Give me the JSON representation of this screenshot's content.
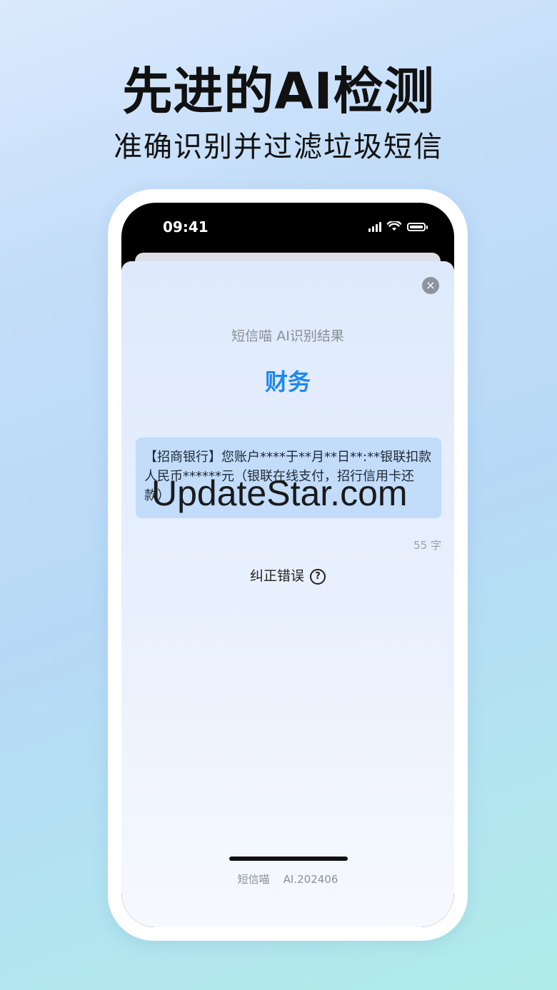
{
  "headline": "先进的AI检测",
  "subheadline": "准确识别并过滤垃圾短信",
  "phone": {
    "status_bar": {
      "time": "09:41"
    },
    "sheet": {
      "close_icon": "×",
      "title": "短信喵 AI识别结果",
      "category": "财务",
      "message": "【招商银行】您账户****于**月**日**:**银联扣款人民币******元（银联在线支付，招行信用卡还款）",
      "watermark": "UpdateStar.com",
      "char_count": "55 字",
      "correct_label": "纠正错误",
      "help_icon": "?",
      "footer": "短信喵    AI.202406"
    }
  },
  "colors": {
    "accent": "#1e88f0"
  }
}
